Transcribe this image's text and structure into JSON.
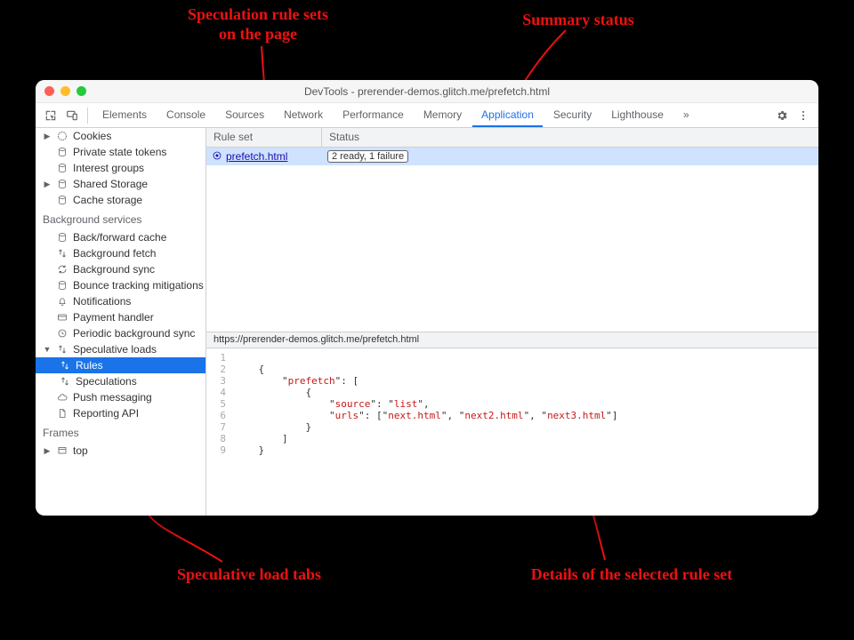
{
  "annotations": {
    "rule_sets": "Speculation rule sets\non the page",
    "summary_status": "Summary status",
    "load_tabs": "Speculative load tabs",
    "details": "Details of the selected rule set"
  },
  "window": {
    "title": "DevTools - prerender-demos.glitch.me/prefetch.html"
  },
  "top_tabs": {
    "elements": "Elements",
    "console": "Console",
    "sources": "Sources",
    "network": "Network",
    "performance": "Performance",
    "memory": "Memory",
    "application": "Application",
    "security": "Security",
    "lighthouse": "Lighthouse"
  },
  "sidebar": {
    "cookies": "Cookies",
    "private_tokens": "Private state tokens",
    "interest_groups": "Interest groups",
    "shared_storage": "Shared Storage",
    "cache_storage": "Cache storage",
    "bg_header": "Background services",
    "back_forward": "Back/forward cache",
    "background_fetch": "Background fetch",
    "background_sync": "Background sync",
    "bounce": "Bounce tracking mitigations",
    "notifications": "Notifications",
    "payment": "Payment handler",
    "periodic": "Periodic background sync",
    "speculative": "Speculative loads",
    "rules": "Rules",
    "speculations": "Speculations",
    "push": "Push messaging",
    "reporting": "Reporting API",
    "frames_header": "Frames",
    "top": "top"
  },
  "table": {
    "col_ruleset": "Rule set",
    "col_status": "Status",
    "row_ruleset": "prefetch.html",
    "row_status": "2 ready, 1 failure"
  },
  "detail": {
    "url": "https://prerender-demos.glitch.me/prefetch.html",
    "code_lines": [
      "1",
      "2",
      "3",
      "4",
      "5",
      "6",
      "7",
      "8",
      "9"
    ],
    "code": {
      "l1": "",
      "l2": "    {",
      "l3a": "        \"",
      "l3b": "prefetch",
      "l3c": "\": [",
      "l4": "            {",
      "l5a": "                \"",
      "l5b": "source",
      "l5c": "\": \"",
      "l5d": "list",
      "l5e": "\",",
      "l6a": "                \"",
      "l6b": "urls",
      "l6c": "\": [\"",
      "l6d": "next.html",
      "l6e": "\", \"",
      "l6f": "next2.html",
      "l6g": "\", \"",
      "l6h": "next3.html",
      "l6i": "\"]",
      "l7": "            }",
      "l8": "        ]",
      "l9": "    }"
    }
  }
}
